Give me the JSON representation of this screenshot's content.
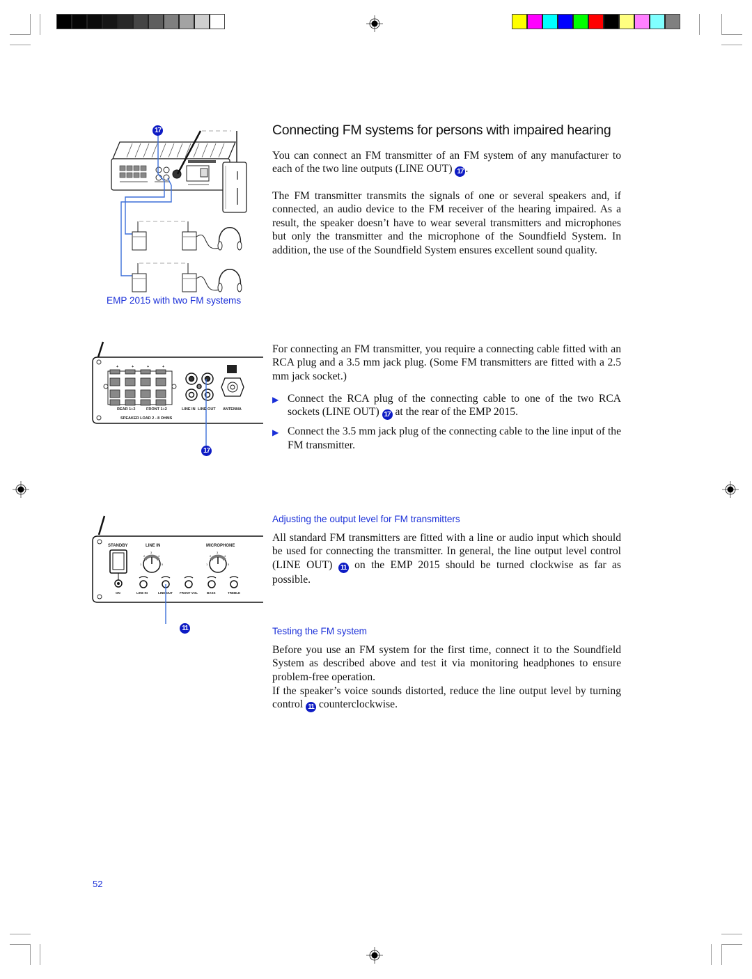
{
  "print_marks": {
    "gray_swatches": [
      "#000000",
      "#050505",
      "#0b0b0b",
      "#161616",
      "#282828",
      "#454545",
      "#5e5e5e",
      "#7f7f7f",
      "#a3a3a3",
      "#cfcfcf",
      "#ffffff"
    ],
    "color_swatches": [
      "#ffff00",
      "#ff00ff",
      "#00ffff",
      "#0000ff",
      "#00ff00",
      "#ff0000",
      "#000000",
      "#ffff80",
      "#ff80ff",
      "#80ffff",
      "#808080"
    ]
  },
  "heading": "Connecting FM systems for persons with impaired hearing",
  "intro": {
    "para1_text": "You can connect an FM transmitter of an FM system of any manufacturer to each of the two line outputs (LINE OUT)",
    "para1_callout": "17",
    "para1_end": ".",
    "para2": "The FM transmitter transmits the signals of one or several speakers and, if connected, an audio device to the FM receiver of the hearing impaired. As a result, the speaker doesn’t have to wear several transmitters and microphones but only the transmitter and the microphone of the Soundfield System. In addition, the use of the Soundfield System ensures excellent sound quality."
  },
  "figure1": {
    "callout": "17",
    "caption": "EMP 2015 with two FM systems"
  },
  "figure2": {
    "callout": "17",
    "labels": {
      "rear": "REAR 1+2",
      "front": "FRONT 1+2",
      "line_in": "LINE IN",
      "line_out": "LINE OUT",
      "antenna": "ANTENNA",
      "speaker_load": "SPEAKER LOAD 2 - 8 OHMS",
      "plus": "+"
    }
  },
  "figure3": {
    "callout": "11",
    "labels": {
      "standby": "STANDBY",
      "line_in_knob": "LINE IN",
      "microphone": "MICROPHONE",
      "on": "ON",
      "line_in": "LINE IN",
      "line_out": "LINE OUT",
      "front_vol": "FRONT VOL",
      "bass": "BASS",
      "treble": "TREBLE",
      "scale": [
        "1",
        "2",
        "3",
        "4",
        "5"
      ]
    }
  },
  "cable": {
    "para": "For connecting an FM transmitter, you require a connecting cable fitted with an RCA plug and a 3.5 mm jack plug. (Some FM transmitters are fitted with a 2.5 mm jack socket.)",
    "bullet1_text": "Connect the RCA plug of the connecting cable to one of the two RCA sockets (LINE OUT)",
    "bullet1_callout": "17",
    "bullet1_end": "at the rear of the EMP 2015.",
    "bullet2": "Connect the 3.5 mm jack plug of the connecting cable to the line input of the FM transmitter."
  },
  "adjusting": {
    "title": "Adjusting the output level for FM transmitters",
    "para_text": "All standard FM transmitters are fitted with a line or audio input which should be used for connecting the transmitter. In general, the line output level control (LINE OUT)",
    "para_callout": "11",
    "para_end": "on the EMP 2015 should be turned clockwise as far as possible."
  },
  "testing": {
    "title": "Testing the FM system",
    "para1": "Before you use an FM system for the first time, connect it to the Soundfield System as described above and test it via monitoring headphones to ensure problem-free operation.",
    "para2_text": "If the speaker’s voice sounds distorted, reduce the line output level by turning control",
    "para2_callout": "11",
    "para2_end": "counterclockwise."
  },
  "page_number": "52"
}
